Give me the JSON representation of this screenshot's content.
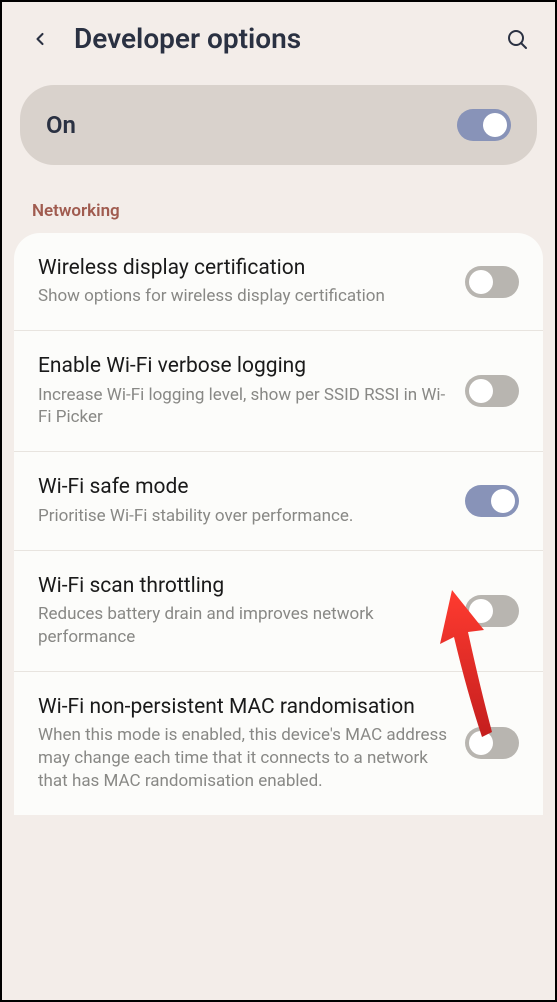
{
  "header": {
    "title": "Developer options"
  },
  "masterSwitch": {
    "label": "On",
    "enabled": true
  },
  "section": {
    "header": "Networking"
  },
  "settings": [
    {
      "title": "Wireless display certification",
      "desc": "Show options for wireless display certification",
      "enabled": false
    },
    {
      "title": "Enable Wi-Fi verbose logging",
      "desc": "Increase Wi-Fi logging level, show per SSID RSSI in Wi-Fi Picker",
      "enabled": false
    },
    {
      "title": "Wi-Fi safe mode",
      "desc": "Prioritise Wi-Fi stability over performance.",
      "enabled": true
    },
    {
      "title": "Wi-Fi scan throttling",
      "desc": "Reduces battery drain and improves network performance",
      "enabled": false
    },
    {
      "title": "Wi-Fi non-persistent MAC randomisation",
      "desc": "When this mode is enabled, this device's MAC address may change each time that it connects to a network that has MAC randomisation enabled.",
      "enabled": false
    }
  ]
}
